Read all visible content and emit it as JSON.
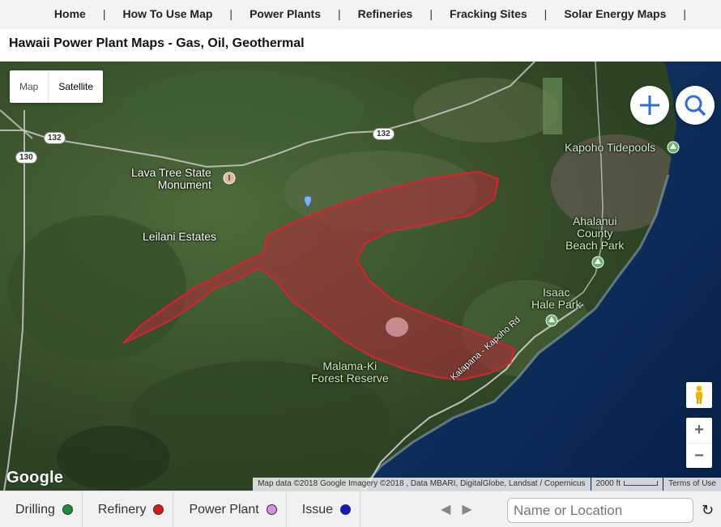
{
  "nav": {
    "items": [
      "Home",
      "How To Use Map",
      "Power Plants",
      "Refineries",
      "Fracking Sites",
      "Solar Energy Maps"
    ],
    "separator": "|"
  },
  "page": {
    "title": "Hawaii Power Plant Maps - Gas, Oil, Geothermal"
  },
  "map": {
    "type_control": {
      "map_label": "Map",
      "satellite_label": "Satellite",
      "selected": "Satellite"
    },
    "zoom_in": "+",
    "zoom_out": "−",
    "labels": {
      "lava_tree_1": "Lava Tree State",
      "lava_tree_2": "Monument",
      "leilani": "Leilani Estates",
      "kapoho": "Kapoho Tidepools",
      "ahalanui_1": "Ahalanui",
      "ahalanui_2": "County",
      "ahalanui_3": "Beach Park",
      "isaac_1": "Isaac",
      "isaac_2": "Hale Park",
      "malama_1": "Malama-Ki",
      "malama_2": "Forest Reserve",
      "road": "Kalapana - Kapoho Rd",
      "shield_130": "130",
      "shield_132a": "132",
      "shield_132b": "132"
    },
    "google_logo": "Google",
    "attribution": {
      "data": "Map data ©2018 Google Imagery ©2018 , Data MBARI, DigitalGlobe, Landsat / Copernicus",
      "scale": "2000 ft",
      "terms": "Terms of Use"
    },
    "colors": {
      "polygon_fill": "#b5283a",
      "polygon_stroke": "#e0202c",
      "ocean": "#0b2a55",
      "land": "#3c5a30"
    }
  },
  "legend": {
    "items": [
      {
        "label": "Drilling",
        "color": "#1a8f3a"
      },
      {
        "label": "Refinery",
        "color": "#d81a1a"
      },
      {
        "label": "Power Plant",
        "color": "#d98ee8"
      },
      {
        "label": "Issue",
        "color": "#1414c8"
      }
    ],
    "prev": "◀",
    "next": "▶",
    "search_placeholder": "Name or Location",
    "refresh_icon": "↻"
  }
}
